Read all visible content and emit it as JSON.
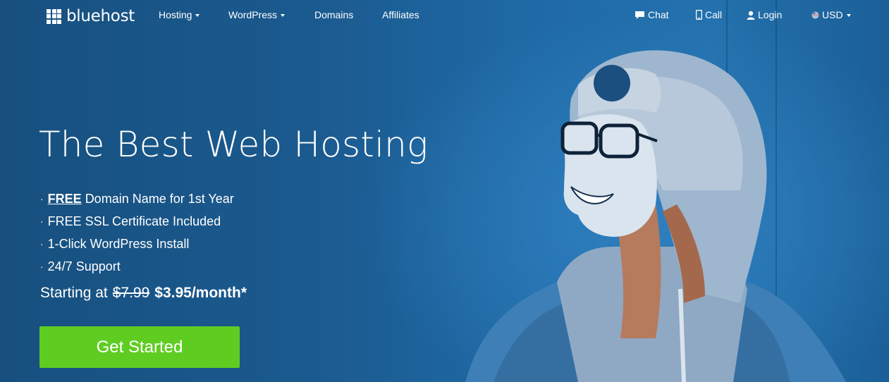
{
  "brand": {
    "name": "bluehost"
  },
  "nav": {
    "left": [
      {
        "label": "Hosting",
        "dropdown": true
      },
      {
        "label": "WordPress",
        "dropdown": true
      },
      {
        "label": "Domains",
        "dropdown": false
      },
      {
        "label": "Affiliates",
        "dropdown": false
      }
    ],
    "right": {
      "chat": {
        "label": "Chat",
        "icon": "chat-bubble-icon"
      },
      "call": {
        "label": "Call",
        "icon": "phone-icon"
      },
      "login": {
        "label": "Login",
        "icon": "user-icon"
      },
      "currency": {
        "label": "USD",
        "icon": "flag-icon",
        "dropdown": true
      }
    }
  },
  "hero": {
    "headline": "The Best Web Hosting",
    "bullets": [
      {
        "dot": "·",
        "emphasis": "FREE",
        "text": "Domain Name for 1st Year"
      },
      {
        "dot": "·",
        "text": "FREE SSL Certificate Included"
      },
      {
        "dot": "·",
        "text": "1-Click WordPress Install"
      },
      {
        "dot": "·",
        "text": "24/7 Support"
      }
    ],
    "pricing": {
      "prefix": "Starting at",
      "old_price": "$7.99",
      "new_price": "$3.95/month*"
    },
    "cta_label": "Get Started"
  },
  "colors": {
    "background": "#1d5d95",
    "cta": "#5fcc21",
    "text": "#ffffff"
  }
}
